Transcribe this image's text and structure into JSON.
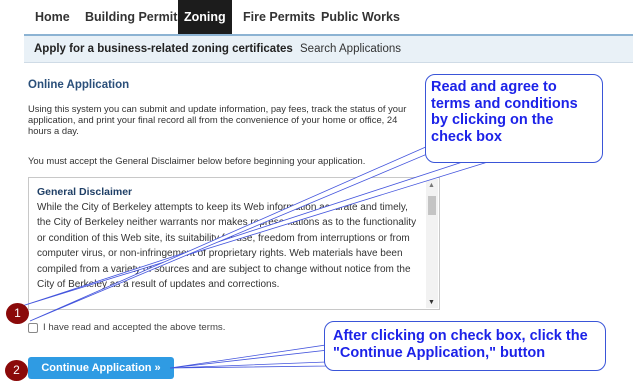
{
  "top_nav": {
    "tabs": [
      {
        "label": "Home",
        "active": false
      },
      {
        "label": "Building Permits",
        "active": false
      },
      {
        "label": "Zoning",
        "active": true
      },
      {
        "label": "Fire Permits",
        "active": false
      },
      {
        "label": "Public Works",
        "active": false
      }
    ]
  },
  "sub_nav": {
    "items": [
      {
        "label": "Apply for a business-related zoning certificates",
        "active": true
      },
      {
        "label": "Search Applications",
        "active": false
      }
    ]
  },
  "main": {
    "title": "Online Application",
    "intro": "Using this system you can submit and update information, pay fees, track the status of your application, and print your final record all from the convenience of your home or office, 24 hours a day.",
    "must_accept": "You must accept the General Disclaimer below before beginning your application.",
    "disclaimer": {
      "title": "General Disclaimer",
      "body": "While the City of Berkeley attempts to keep its Web information accurate and timely, the City of Berkeley neither warrants nor makes representations as to the functionality or condition of this Web site, its suitability for use, freedom from interruptions or from computer virus, or non-infringement of proprietary rights. Web materials have been compiled from a variety of sources and are subject to change without notice from the City of Berkeley as a result of updates and corrections."
    },
    "accept_label": "I have read and accepted the above terms.",
    "accept_checked": false,
    "continue_button": "Continue Application »"
  },
  "annotations": {
    "badge1": "1",
    "badge2": "2",
    "callout1": "Read and agree to terms and conditions by clicking on the check box",
    "callout2": "After clicking on check box, click the \"Continue Application,\" button",
    "badge_color": "#8b0a0a",
    "callout_text_color": "#1c22e8"
  },
  "colors": {
    "active_tab_bg": "#1c1c1c",
    "subnav_bg": "#e9f1f7",
    "button_bg": "#2f9be3",
    "heading_color": "#2a4f7a"
  }
}
